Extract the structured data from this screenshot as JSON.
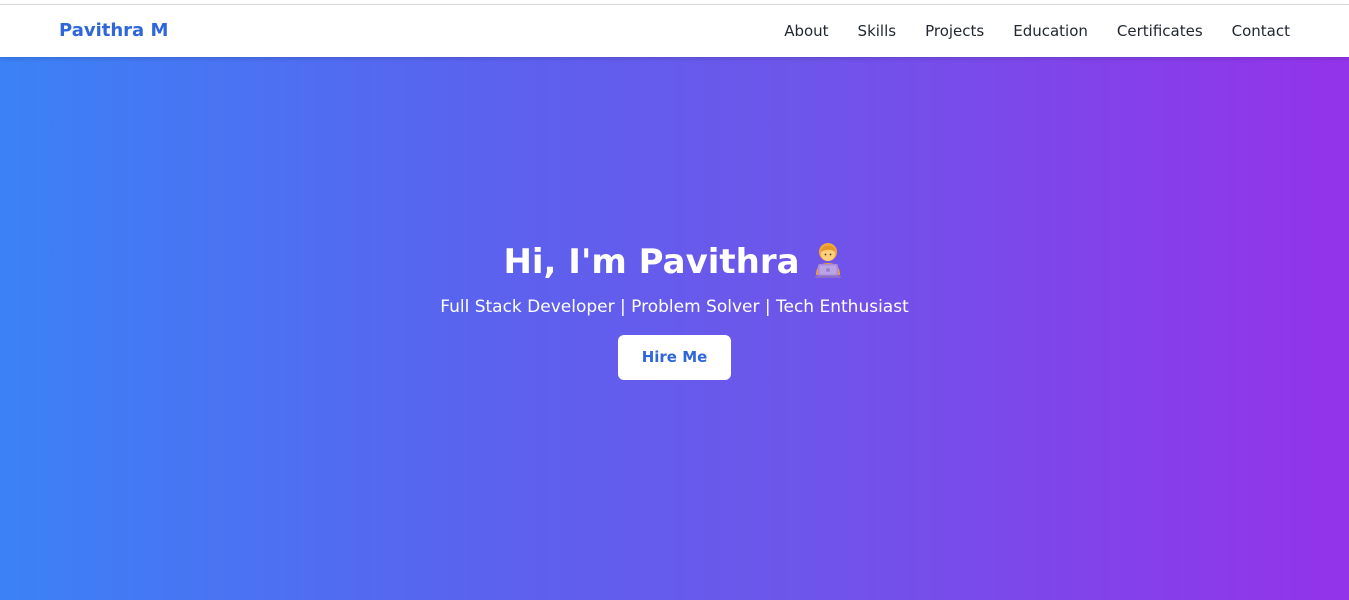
{
  "navbar": {
    "brand": "Pavithra M",
    "links": [
      {
        "label": "About"
      },
      {
        "label": "Skills"
      },
      {
        "label": "Projects"
      },
      {
        "label": "Education"
      },
      {
        "label": "Certificates"
      },
      {
        "label": "Contact"
      }
    ]
  },
  "hero": {
    "title": "Hi, I'm Pavithra",
    "emoji_icon": "woman-technologist-icon",
    "subtitle": "Full Stack Developer | Problem Solver | Tech Enthusiast",
    "cta_label": "Hire Me"
  },
  "colors": {
    "brand": "#2f67db",
    "gradient_start": "#3b82f6",
    "gradient_end": "#9333ea",
    "nav_text": "#222831"
  }
}
